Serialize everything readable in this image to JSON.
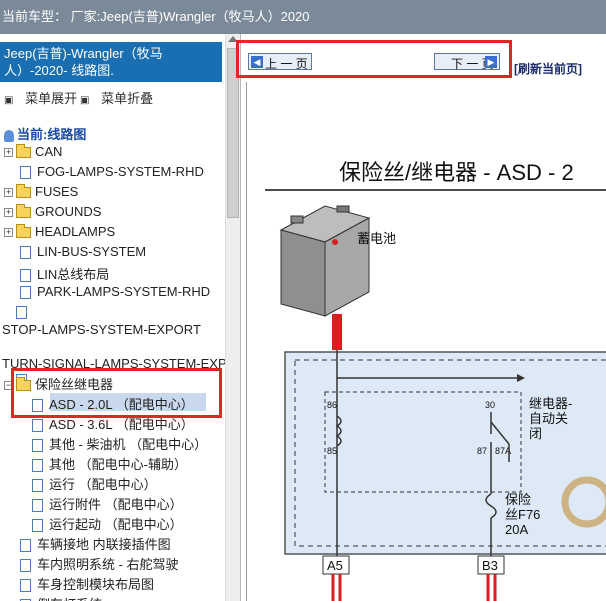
{
  "topbar": {
    "label": "当前车型：",
    "model": "厂家:Jeep(吉普)Wrangler（牧马人）2020"
  },
  "left": {
    "heading": "Jeep(吉普)-Wrangler（牧马人）-2020- 线路图.",
    "expand": "菜单展开",
    "collapse": "菜单折叠",
    "current": "当前:线路图",
    "items": [
      {
        "label": "CAN",
        "type": "folder"
      },
      {
        "label": "FOG-LAMPS-SYSTEM-RHD",
        "type": "doc"
      },
      {
        "label": "FUSES",
        "type": "folder"
      },
      {
        "label": "GROUNDS",
        "type": "folder"
      },
      {
        "label": "HEADLAMPS",
        "type": "folder"
      },
      {
        "label": "LIN-BUS-SYSTEM",
        "type": "doc"
      },
      {
        "label": "LIN总线布局",
        "type": "doc"
      },
      {
        "label": "PARK-LAMPS-SYSTEM-RHD",
        "type": "doc"
      },
      {
        "label": "STOP-LAMPS-SYSTEM-EXPORT",
        "type": "doc"
      },
      {
        "label": "TURN-SIGNAL-LAMPS-SYSTEM-EXP",
        "type": "doc"
      },
      {
        "label": "保险丝继电器",
        "type": "folder-open"
      },
      {
        "label": "ASD - 2.0L （配电中心）",
        "type": "doc",
        "selected": true
      },
      {
        "label": "ASD - 3.6L （配电中心）",
        "type": "doc"
      },
      {
        "label": "其他 - 柴油机 （配电中心）",
        "type": "doc"
      },
      {
        "label": "其他 （配电中心-辅助）",
        "type": "doc"
      },
      {
        "label": "运行 （配电中心）",
        "type": "doc"
      },
      {
        "label": "运行附件 （配电中心）",
        "type": "doc"
      },
      {
        "label": "运行起动 （配电中心）",
        "type": "doc"
      },
      {
        "label": "车辆接地 内联接插件图",
        "type": "doc"
      },
      {
        "label": "车内照明系统 - 右舵驾驶",
        "type": "doc"
      },
      {
        "label": "车身控制模块布局图",
        "type": "doc"
      },
      {
        "label": "倒车灯系统",
        "type": "doc"
      }
    ]
  },
  "nav": {
    "prev": "上 一 页",
    "next": "下 一 页",
    "refresh": "[刷新当前页]"
  },
  "diagram": {
    "title": "保险丝/继电器 - ASD - 2",
    "battery_label": "蓄电池",
    "relay_label_1": "继电器-",
    "relay_label_2": "自动关",
    "relay_label_3": "闭",
    "pin86": "86",
    "pin85": "85",
    "pin30": "30",
    "pin87": "87",
    "pin87a": "87A",
    "fuse_label_1": "保险",
    "fuse_label_2": "丝F76",
    "fuse_label_3": "20A",
    "conn_a5": "A5",
    "conn_b3": "B3"
  },
  "colors": {
    "accent": "#1a6eb2",
    "highlight": "#e02626",
    "wire_red": "#d42020",
    "panel_fill": "#dde9f6"
  }
}
